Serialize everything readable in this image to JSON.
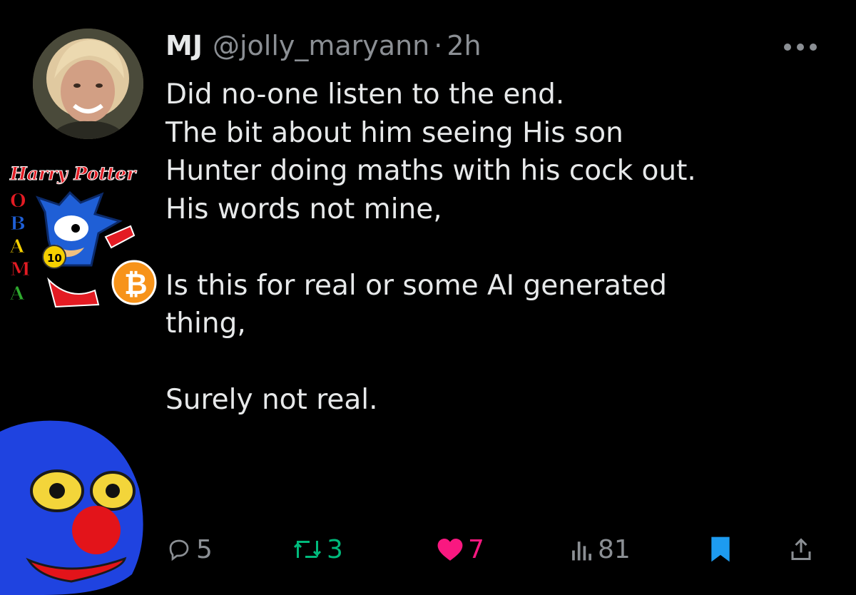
{
  "tweet": {
    "display_name": "MJ",
    "handle": "@jolly_maryann",
    "separator": "·",
    "time": "2h",
    "body": "Did no-one listen to the end.\nThe bit about him seeing His son\nHunter doing maths with his cock out.\nHis words not mine,\n\nIs this for real or some AI generated\nthing,\n\nSurely not real."
  },
  "actions": {
    "reply_count": "5",
    "retweet_count": "3",
    "like_count": "7",
    "views_count": "81"
  },
  "sticker": {
    "title": "Harry Potter",
    "letters": [
      "O",
      "B",
      "A",
      "M",
      "A"
    ],
    "badge_number": "10",
    "coin_symbol": "₿"
  },
  "colors": {
    "background": "#000000",
    "text": "#e7e9ea",
    "muted": "#8b8f94",
    "retweet": "#00ba7c",
    "like": "#f91880",
    "bookmark": "#1d9bf0"
  },
  "icons": [
    "more-icon",
    "reply-icon",
    "retweet-icon",
    "heart-icon",
    "views-icon",
    "bookmark-icon",
    "share-icon"
  ]
}
